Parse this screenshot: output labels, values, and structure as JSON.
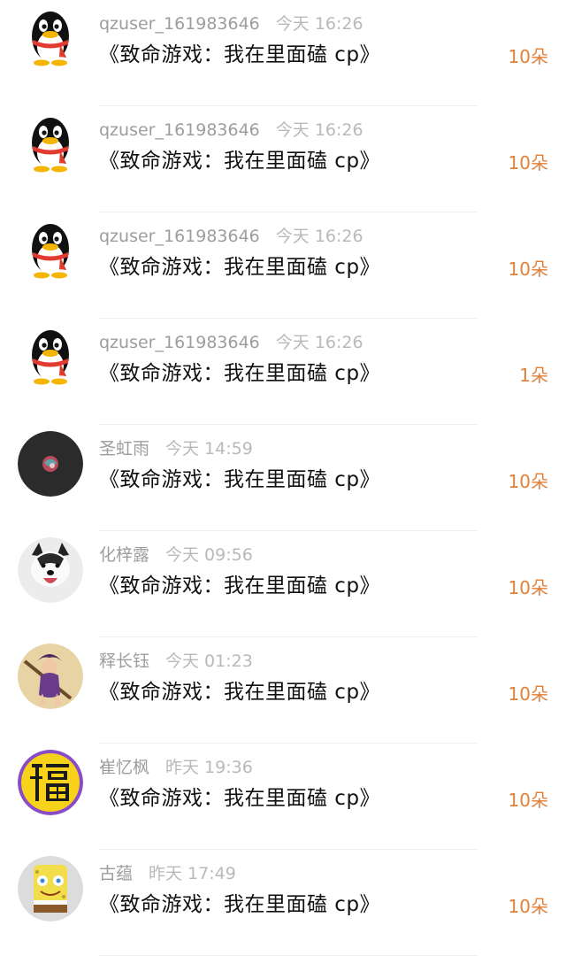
{
  "colors": {
    "amount": "#e0813a",
    "username": "#9d9d9d",
    "title": "#111111"
  },
  "rewards": [
    {
      "avatar": "qq-penguin-icon",
      "username": "qzuser_161983646",
      "time": "今天 16:26",
      "book": "《致命游戏：我在里面磕 cp》",
      "amount": "10朵"
    },
    {
      "avatar": "qq-penguin-icon",
      "username": "qzuser_161983646",
      "time": "今天 16:26",
      "book": "《致命游戏：我在里面磕 cp》",
      "amount": "10朵"
    },
    {
      "avatar": "qq-penguin-icon",
      "username": "qzuser_161983646",
      "time": "今天 16:26",
      "book": "《致命游戏：我在里面磕 cp》",
      "amount": "10朵"
    },
    {
      "avatar": "qq-penguin-icon",
      "username": "qzuser_161983646",
      "time": "今天 16:26",
      "book": "《致命游戏：我在里面磕 cp》",
      "amount": "1朵"
    },
    {
      "avatar": "dark-circle-avatar",
      "username": "圣虹雨",
      "time": "今天 14:59",
      "book": "《致命游戏：我在里面磕 cp》",
      "amount": "10朵"
    },
    {
      "avatar": "husky-dog-avatar",
      "username": "化梓露",
      "time": "今天 09:56",
      "book": "《致命游戏：我在里面磕 cp》",
      "amount": "10朵"
    },
    {
      "avatar": "game-character-avatar",
      "username": "释长钰",
      "time": "今天 01:23",
      "book": "《致命游戏：我在里面磕 cp》",
      "amount": "10朵"
    },
    {
      "avatar": "fu-character-avatar",
      "username": "崔忆枫",
      "time": "昨天 19:36",
      "book": "《致命游戏：我在里面磕 cp》",
      "amount": "10朵"
    },
    {
      "avatar": "spongebob-avatar",
      "username": "古蕴",
      "time": "昨天 17:49",
      "book": "《致命游戏：我在里面磕 cp》",
      "amount": "10朵"
    }
  ]
}
